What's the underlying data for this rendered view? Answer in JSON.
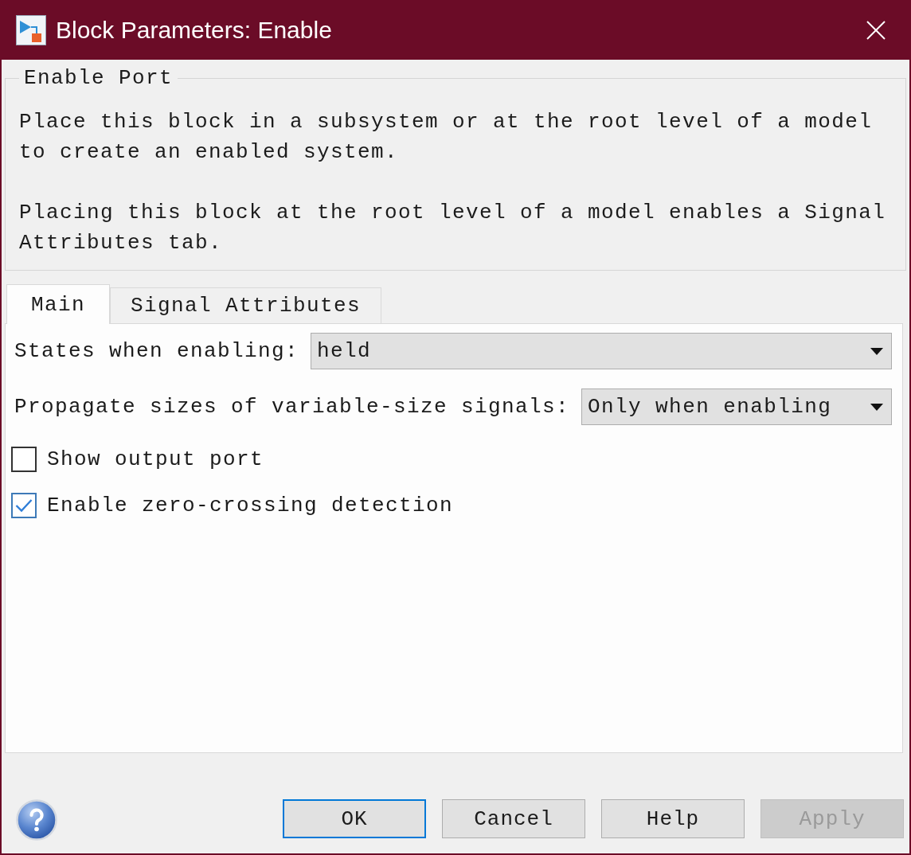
{
  "window": {
    "title": "Block Parameters: Enable"
  },
  "description": {
    "title": "Enable Port",
    "paragraphs": [
      "Place this block in a subsystem or at the root level of a model to create an enabled system.",
      "Placing this block at the root level of a model enables a Signal Attributes tab."
    ]
  },
  "tabs": [
    {
      "label": "Main",
      "selected": true
    },
    {
      "label": "Signal Attributes",
      "selected": false
    }
  ],
  "parameters": [
    {
      "kind": "dropdown",
      "label": "States when enabling:",
      "value": "held"
    },
    {
      "kind": "dropdown",
      "label": "Propagate sizes of variable-size signals:",
      "value": "Only when enabling"
    },
    {
      "kind": "checkbox",
      "label": "Show output port",
      "checked": false
    },
    {
      "kind": "checkbox",
      "label": "Enable zero-crossing detection",
      "checked": true
    }
  ],
  "buttons": [
    {
      "label": "OK",
      "default": true,
      "disabled": false
    },
    {
      "label": "Cancel",
      "default": false,
      "disabled": false
    },
    {
      "label": "Help",
      "default": false,
      "disabled": false
    },
    {
      "label": "Apply",
      "default": false,
      "disabled": true
    }
  ]
}
